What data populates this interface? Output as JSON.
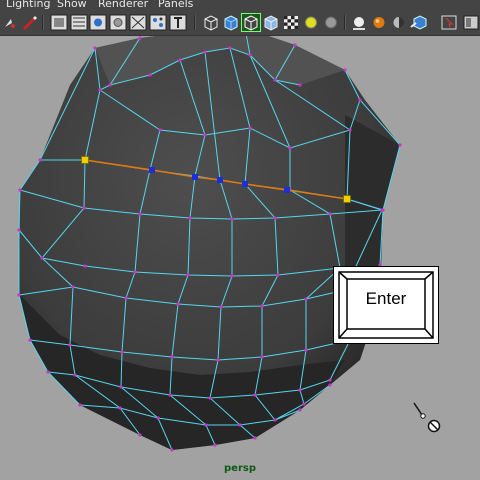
{
  "menubar": {
    "items": [
      {
        "label": "Lighting"
      },
      {
        "label": "Show"
      },
      {
        "label": "Renderer"
      },
      {
        "label": "Panels"
      }
    ]
  },
  "toolbar": {
    "icons": [
      "select-camera-icon",
      "bookmark-pen-icon",
      "wireframe-icon",
      "film-gate-icon",
      "resolution-gate-icon",
      "safe-action-icon",
      "field-chart-icon",
      "grid-icon",
      "image-plane-icon",
      "smooth-shade-wireframe-icon",
      "smooth-shade-all-icon",
      "wireframe-on-shaded-icon",
      "x-ray-icon",
      "textured-icon",
      "use-all-lights-icon",
      "shadows-icon",
      "default-material-icon",
      "isolate-select-icon",
      "camera-attributes-icon",
      "select-tool-icon"
    ]
  },
  "viewport": {
    "camera_label": "persp",
    "selected_edge_color": "#e07a10",
    "wire_color": "#55d6ee",
    "vertex_color": "#cc33cc"
  },
  "overlay": {
    "key_label": "Enter"
  },
  "cursor": {
    "icon": "paint-brush-cursor-icon"
  }
}
